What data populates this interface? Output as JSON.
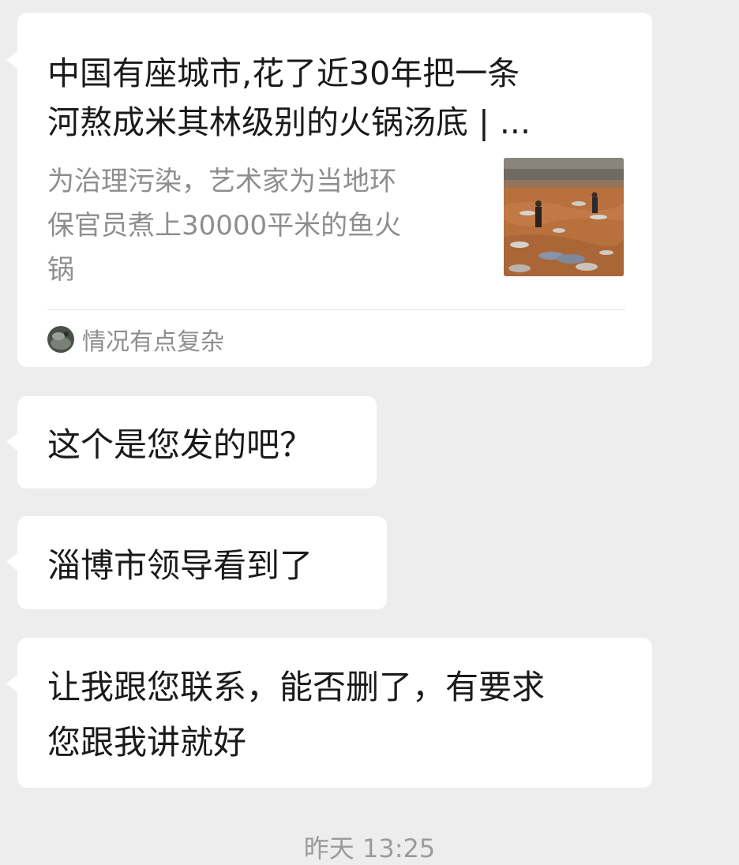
{
  "chat": {
    "article_card": {
      "title": "中国有座城市,花了近30年把一条\n河熬成米其林级别的火锅汤底 | ...",
      "description": "为治理污染，艺术家为当地环\n保官员煮上30000平米的鱼火\n锅",
      "thumbnail_icon": "river-photo-thumbnail",
      "source_avatar_icon": "avatar-icon",
      "source_name": "情况有点复杂"
    },
    "messages": [
      {
        "text": "这个是您发的吧？"
      },
      {
        "text": "淄博市领导看到了"
      },
      {
        "text": "让我跟您联系，能否删了，有要求\n您跟我讲就好"
      }
    ],
    "timestamp": "昨天 13:25"
  },
  "colors": {
    "background": "#ededed",
    "bubble": "#ffffff",
    "text_primary": "#1a1a1a",
    "text_secondary": "#8e8e8e"
  }
}
